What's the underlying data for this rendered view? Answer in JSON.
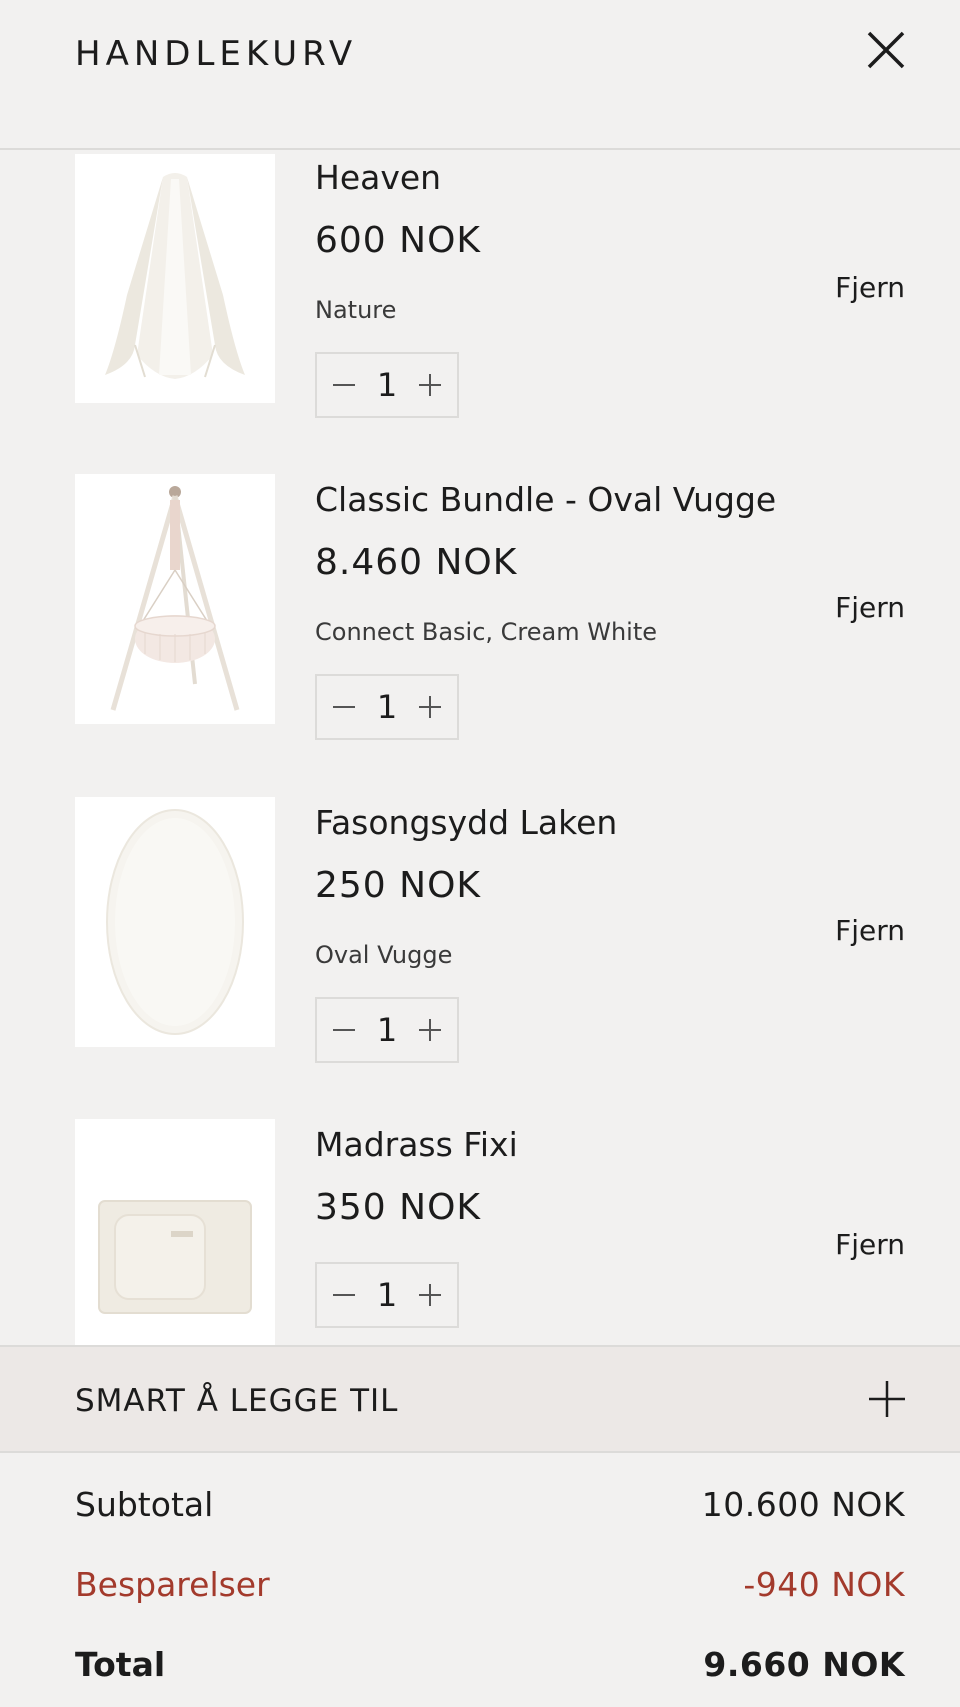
{
  "header": {
    "title": "HANDLEKURV",
    "close_icon": "close-icon"
  },
  "items": [
    {
      "name": "Heaven",
      "price": "600 NOK",
      "variant": "Nature",
      "quantity": "1",
      "remove_label": "Fjern",
      "image": "canopy"
    },
    {
      "name": "Classic Bundle - Oval Vugge",
      "price": "8.460 NOK",
      "variant": "Connect Basic, Cream White",
      "quantity": "1",
      "remove_label": "Fjern",
      "image": "cradle-stand"
    },
    {
      "name": "Fasongsydd Laken",
      "price": "250 NOK",
      "variant": "Oval Vugge",
      "quantity": "1",
      "remove_label": "Fjern",
      "image": "oval-sheet"
    },
    {
      "name": "Madrass Fixi",
      "price": "350 NOK",
      "variant": "",
      "quantity": "1",
      "remove_label": "Fjern",
      "image": "mattress"
    }
  ],
  "smart_add": {
    "label": "SMART Å LEGGE TIL",
    "icon": "plus-icon"
  },
  "summary": {
    "subtotal_label": "Subtotal",
    "subtotal_value": "10.600 NOK",
    "savings_label": "Besparelser",
    "savings_value": "-940 NOK",
    "total_label": "Total",
    "total_value": "9.660 NOK"
  },
  "colors": {
    "background": "#f2f1f0",
    "savings": "#a33a2c",
    "smart_bg": "#ece8e6",
    "text": "#1c1c1c"
  }
}
